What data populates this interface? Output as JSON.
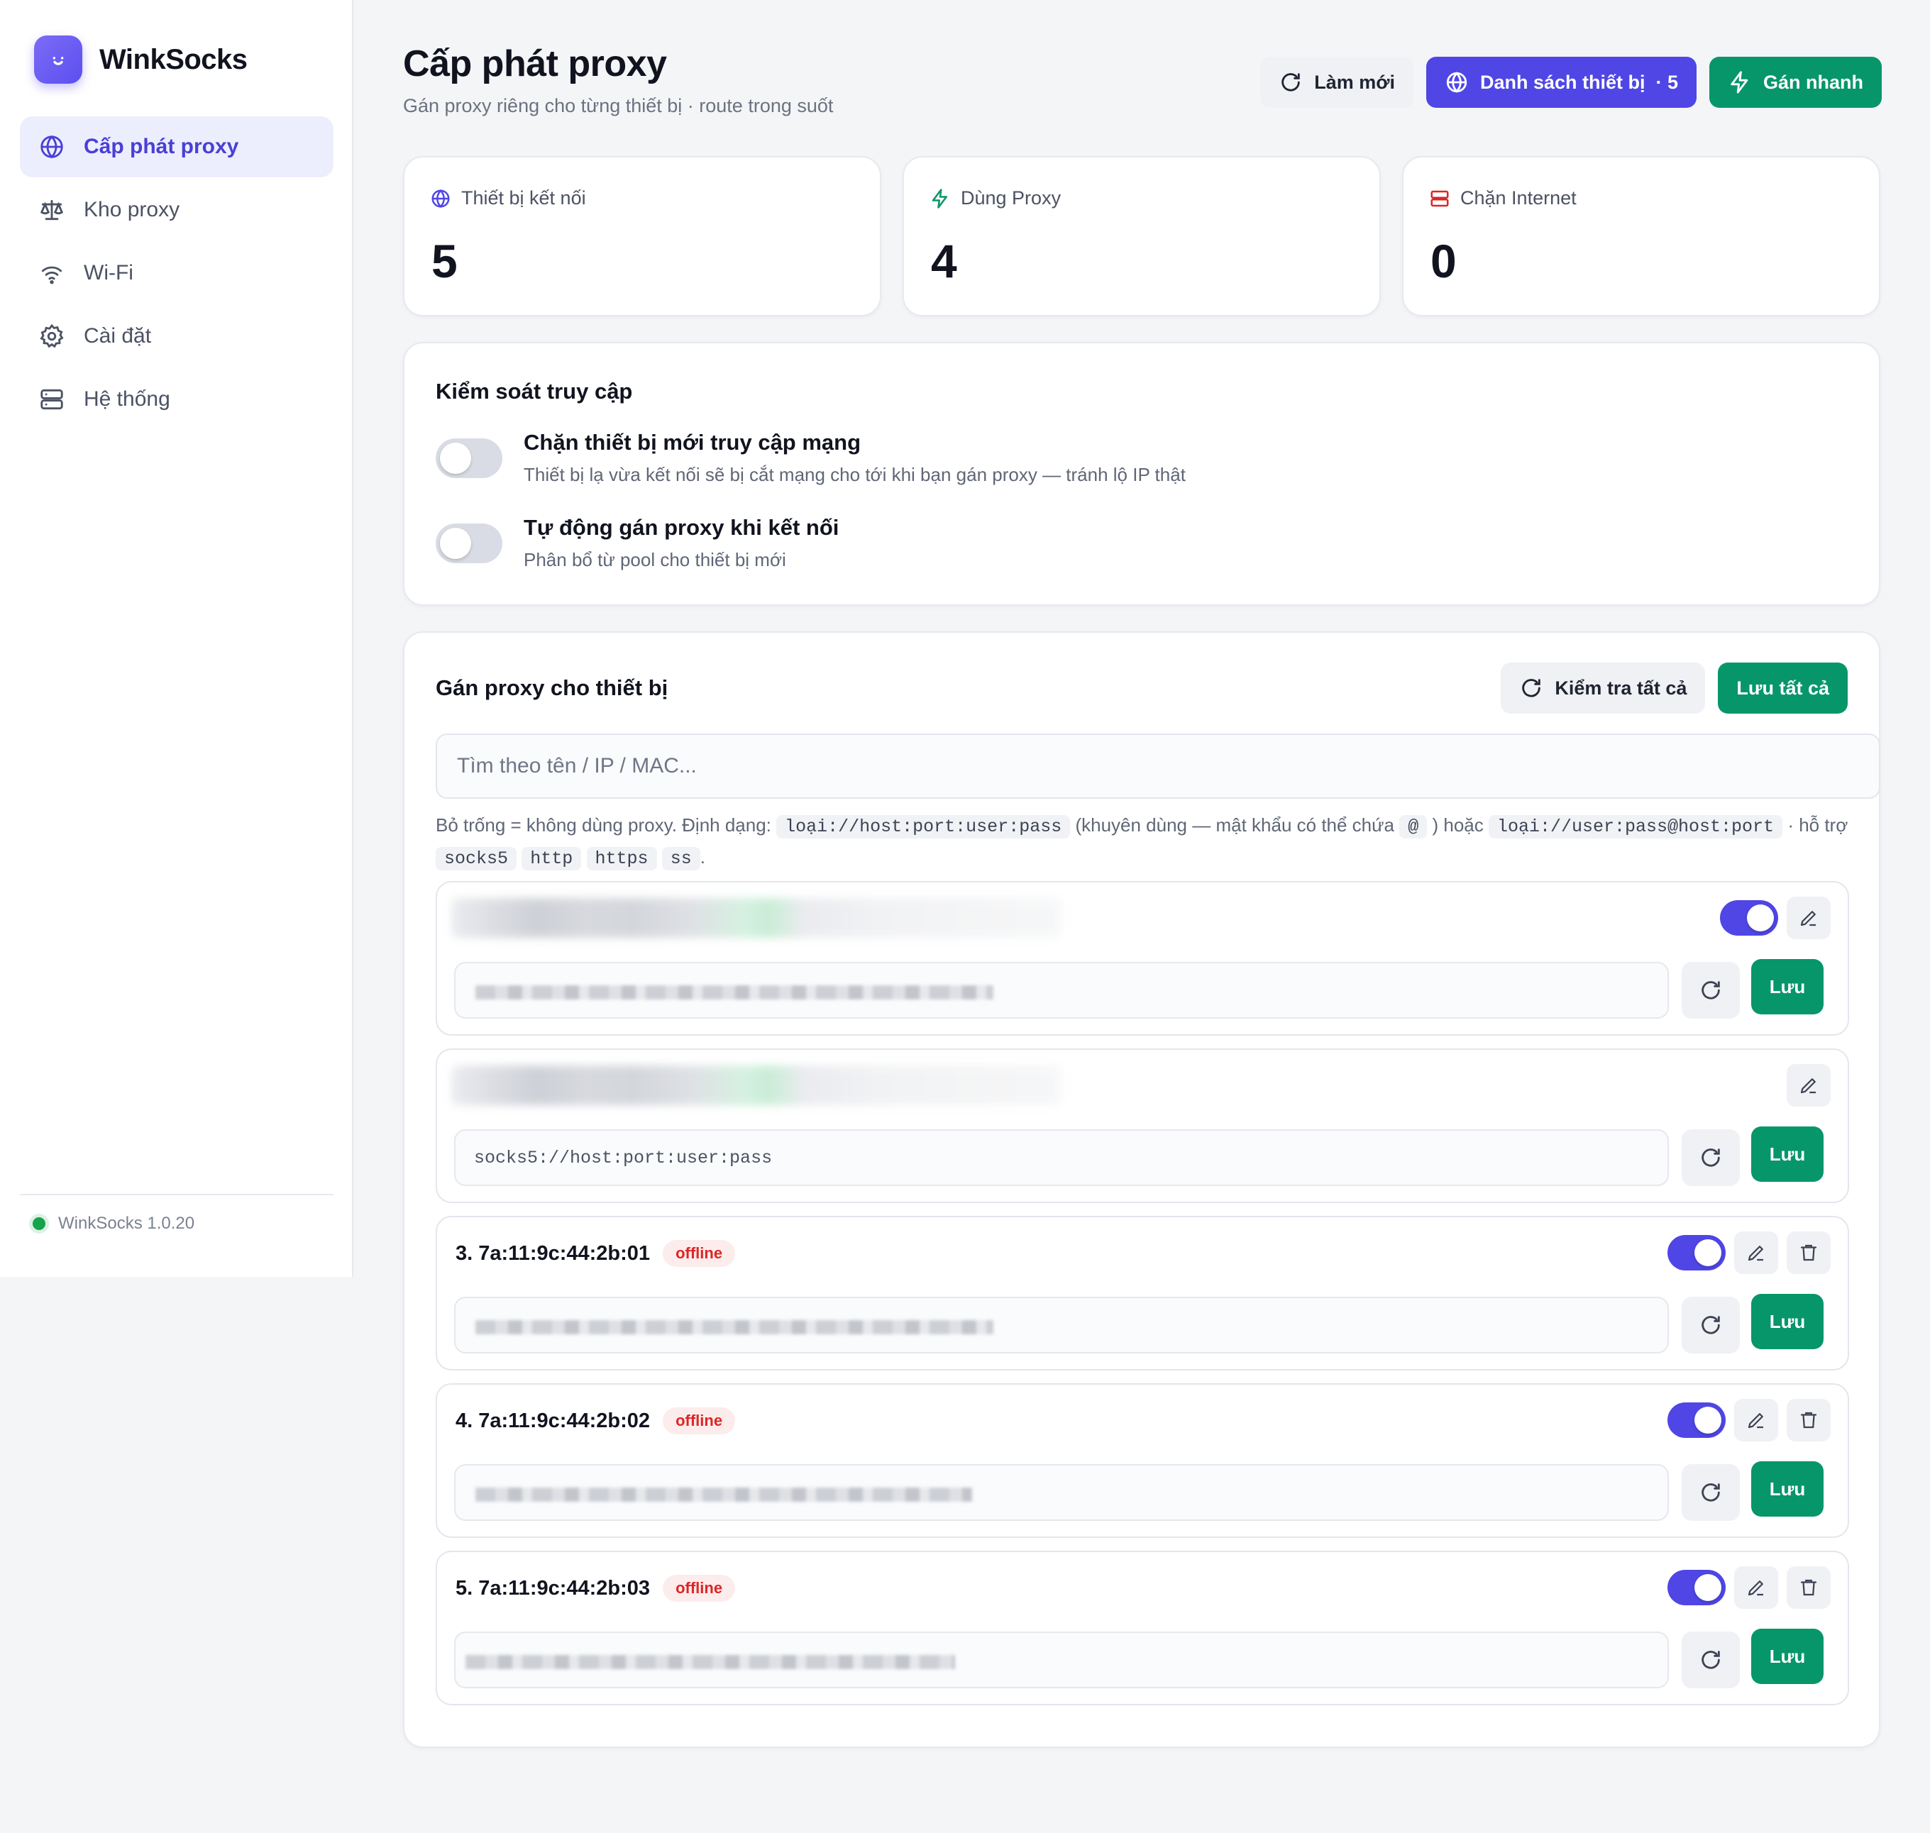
{
  "app": {
    "name": "WinkSocks",
    "version": "WinkSocks 1.0.20"
  },
  "nav": [
    {
      "label": "Cấp phát proxy",
      "icon": "globe-icon",
      "active": true
    },
    {
      "label": "Kho proxy",
      "icon": "scale-icon"
    },
    {
      "label": "Wi-Fi",
      "icon": "wifi-icon"
    },
    {
      "label": "Cài đặt",
      "icon": "gear-icon"
    },
    {
      "label": "Hệ thống",
      "icon": "server-icon"
    }
  ],
  "header": {
    "title": "Cấp phát proxy",
    "subtitle": "Gán proxy riêng cho từng thiết bị · route trong suốt",
    "refresh_label": "Làm mới",
    "devices_label": "Danh sách thiết bị  · 5",
    "quick_assign_label": "Gán nhanh"
  },
  "stats": [
    {
      "label": "Thiết bị kết nối",
      "value": "5",
      "color": "#4f46e5"
    },
    {
      "label": "Dùng Proxy",
      "value": "4",
      "color": "#079669"
    },
    {
      "label": "Chặn Internet",
      "value": "0",
      "color": "#dc2626"
    }
  ],
  "access": {
    "title": "Kiểm soát truy cập",
    "block_new": {
      "title": "Chặn thiết bị mới truy cập mạng",
      "desc": "Thiết bị lạ vừa kết nối sẽ bị cắt mạng cho tới khi bạn gán proxy — tránh lộ IP thật",
      "on": false
    },
    "auto_assign": {
      "title": "Tự động gán proxy khi kết nối",
      "desc": "Phân bổ từ pool cho thiết bị mới",
      "on": false
    }
  },
  "assign": {
    "title": "Gán proxy cho thiết bị",
    "check_all_label": "Kiểm tra tất cả",
    "save_all_label": "Lưu tất cả",
    "search_placeholder": "Tìm theo tên / IP / MAC...",
    "help": {
      "t1": "Bỏ trống = không dùng proxy. Định dạng:",
      "c1": "loại://host:port:user:pass",
      "t2": "(khuyên dùng — mật khẩu có thể chứa",
      "c2": "@",
      "t3": ") hoặc",
      "c3": "loại://user:pass@host:port",
      "t4": "· hỗ trợ",
      "c4": "socks5",
      "c5": "http",
      "c6": "https",
      "c7": "ss",
      "t5": "."
    },
    "input_placeholder": "socks5://host:port:user:pass",
    "save_label": "Lưu",
    "offline_label": "offline",
    "devices": [
      {
        "title": "",
        "enabled": true
      },
      {
        "title": ""
      },
      {
        "title": "3. 7a:11:9c:44:2b:01",
        "enabled": true
      },
      {
        "title": "4. 7a:11:9c:44:2b:02",
        "enabled": true
      },
      {
        "title": "5. 7a:11:9c:44:2b:03",
        "enabled": true
      }
    ]
  }
}
